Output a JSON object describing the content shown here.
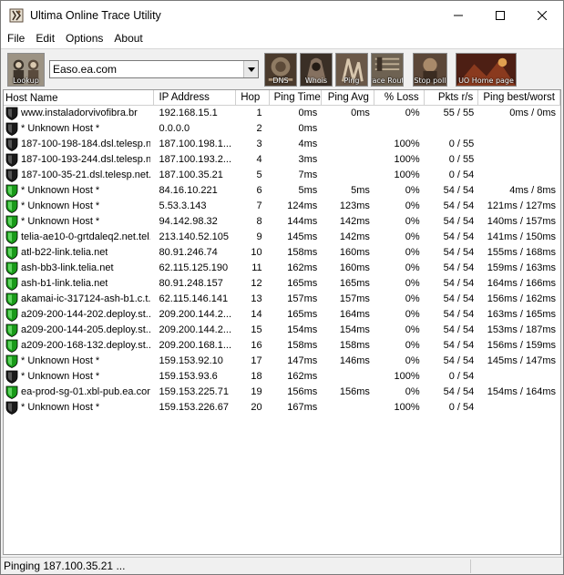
{
  "window": {
    "title": "Ultima Online Trace Utility"
  },
  "menu": [
    "File",
    "Edit",
    "Options",
    "About"
  ],
  "toolbar": {
    "host_value": "Easo.ea.com",
    "buttons": [
      {
        "label": "Lookup",
        "icon": "portrait-icon"
      },
      {
        "label": "DNS",
        "icon": "dns-icon"
      },
      {
        "label": "Whois",
        "icon": "whois-icon"
      },
      {
        "label": "Ping",
        "icon": "ping-icon"
      },
      {
        "label": "Trace Route",
        "icon": "trace-route-icon"
      },
      {
        "label": "Stop poll",
        "icon": "stop-poll-icon"
      },
      {
        "label": "UO Home page",
        "icon": "home-page-icon"
      }
    ]
  },
  "table": {
    "columns": [
      "Host Name",
      "IP Address",
      "Hop",
      "Ping Time",
      "Ping Avg",
      "% Loss",
      "Pkts r/s",
      "Ping best/worst"
    ],
    "rows": [
      {
        "status": "down",
        "host": "www.instaladorvivofibra.br",
        "ip": "192.168.15.1",
        "hop": "1",
        "time": "0ms",
        "avg": "0ms",
        "loss": "0%",
        "pkts": "55 / 55",
        "best": "0ms / 0ms"
      },
      {
        "status": "down",
        "host": "* Unknown Host *",
        "ip": "0.0.0.0",
        "hop": "2",
        "time": "0ms",
        "avg": "",
        "loss": "",
        "pkts": "",
        "best": ""
      },
      {
        "status": "down",
        "host": "187-100-198-184.dsl.telesp.n...",
        "ip": "187.100.198.1...",
        "hop": "3",
        "time": "4ms",
        "avg": "",
        "loss": "100%",
        "pkts": "0 / 55",
        "best": ""
      },
      {
        "status": "down",
        "host": "187-100-193-244.dsl.telesp.n...",
        "ip": "187.100.193.2...",
        "hop": "4",
        "time": "3ms",
        "avg": "",
        "loss": "100%",
        "pkts": "0 / 55",
        "best": ""
      },
      {
        "status": "down",
        "host": "187-100-35-21.dsl.telesp.net...",
        "ip": "187.100.35.21",
        "hop": "5",
        "time": "7ms",
        "avg": "",
        "loss": "100%",
        "pkts": "0 / 54",
        "best": ""
      },
      {
        "status": "up",
        "host": "* Unknown Host *",
        "ip": "84.16.10.221",
        "hop": "6",
        "time": "5ms",
        "avg": "5ms",
        "loss": "0%",
        "pkts": "54 / 54",
        "best": "4ms / 8ms"
      },
      {
        "status": "up",
        "host": "* Unknown Host *",
        "ip": "5.53.3.143",
        "hop": "7",
        "time": "124ms",
        "avg": "123ms",
        "loss": "0%",
        "pkts": "54 / 54",
        "best": "121ms / 127ms"
      },
      {
        "status": "up",
        "host": "* Unknown Host *",
        "ip": "94.142.98.32",
        "hop": "8",
        "time": "144ms",
        "avg": "142ms",
        "loss": "0%",
        "pkts": "54 / 54",
        "best": "140ms / 157ms"
      },
      {
        "status": "up",
        "host": "telia-ae10-0-grtdaleq2.net.tel...",
        "ip": "213.140.52.105",
        "hop": "9",
        "time": "145ms",
        "avg": "142ms",
        "loss": "0%",
        "pkts": "54 / 54",
        "best": "141ms / 150ms"
      },
      {
        "status": "up",
        "host": "atl-b22-link.telia.net",
        "ip": "80.91.246.74",
        "hop": "10",
        "time": "158ms",
        "avg": "160ms",
        "loss": "0%",
        "pkts": "54 / 54",
        "best": "155ms / 168ms"
      },
      {
        "status": "up",
        "host": "ash-bb3-link.telia.net",
        "ip": "62.115.125.190",
        "hop": "11",
        "time": "162ms",
        "avg": "160ms",
        "loss": "0%",
        "pkts": "54 / 54",
        "best": "159ms / 163ms"
      },
      {
        "status": "up",
        "host": "ash-b1-link.telia.net",
        "ip": "80.91.248.157",
        "hop": "12",
        "time": "165ms",
        "avg": "165ms",
        "loss": "0%",
        "pkts": "54 / 54",
        "best": "164ms / 166ms"
      },
      {
        "status": "up",
        "host": "akamai-ic-317124-ash-b1.c.t...",
        "ip": "62.115.146.141",
        "hop": "13",
        "time": "157ms",
        "avg": "157ms",
        "loss": "0%",
        "pkts": "54 / 54",
        "best": "156ms / 162ms"
      },
      {
        "status": "up",
        "host": "a209-200-144-202.deploy.st...",
        "ip": "209.200.144.2...",
        "hop": "14",
        "time": "165ms",
        "avg": "164ms",
        "loss": "0%",
        "pkts": "54 / 54",
        "best": "163ms / 165ms"
      },
      {
        "status": "up",
        "host": "a209-200-144-205.deploy.st...",
        "ip": "209.200.144.2...",
        "hop": "15",
        "time": "154ms",
        "avg": "154ms",
        "loss": "0%",
        "pkts": "54 / 54",
        "best": "153ms / 187ms"
      },
      {
        "status": "up",
        "host": "a209-200-168-132.deploy.st...",
        "ip": "209.200.168.1...",
        "hop": "16",
        "time": "158ms",
        "avg": "158ms",
        "loss": "0%",
        "pkts": "54 / 54",
        "best": "156ms / 159ms"
      },
      {
        "status": "up",
        "host": "* Unknown Host *",
        "ip": "159.153.92.10",
        "hop": "17",
        "time": "147ms",
        "avg": "146ms",
        "loss": "0%",
        "pkts": "54 / 54",
        "best": "145ms / 147ms"
      },
      {
        "status": "down",
        "host": "* Unknown Host *",
        "ip": "159.153.93.6",
        "hop": "18",
        "time": "162ms",
        "avg": "",
        "loss": "100%",
        "pkts": "0 / 54",
        "best": ""
      },
      {
        "status": "up",
        "host": "ea-prod-sg-01.xbl-pub.ea.com",
        "ip": "159.153.225.71",
        "hop": "19",
        "time": "156ms",
        "avg": "156ms",
        "loss": "0%",
        "pkts": "54 / 54",
        "best": "154ms / 164ms"
      },
      {
        "status": "down",
        "host": "* Unknown Host *",
        "ip": "159.153.226.67",
        "hop": "20",
        "time": "167ms",
        "avg": "",
        "loss": "100%",
        "pkts": "0 / 54",
        "best": ""
      }
    ]
  },
  "colors": {
    "up": "#1a9a1a",
    "down": "#1a1a1a",
    "toolbar_bg": "#f0f0f0"
  },
  "status": {
    "text": "Pinging 187.100.35.21 ..."
  }
}
